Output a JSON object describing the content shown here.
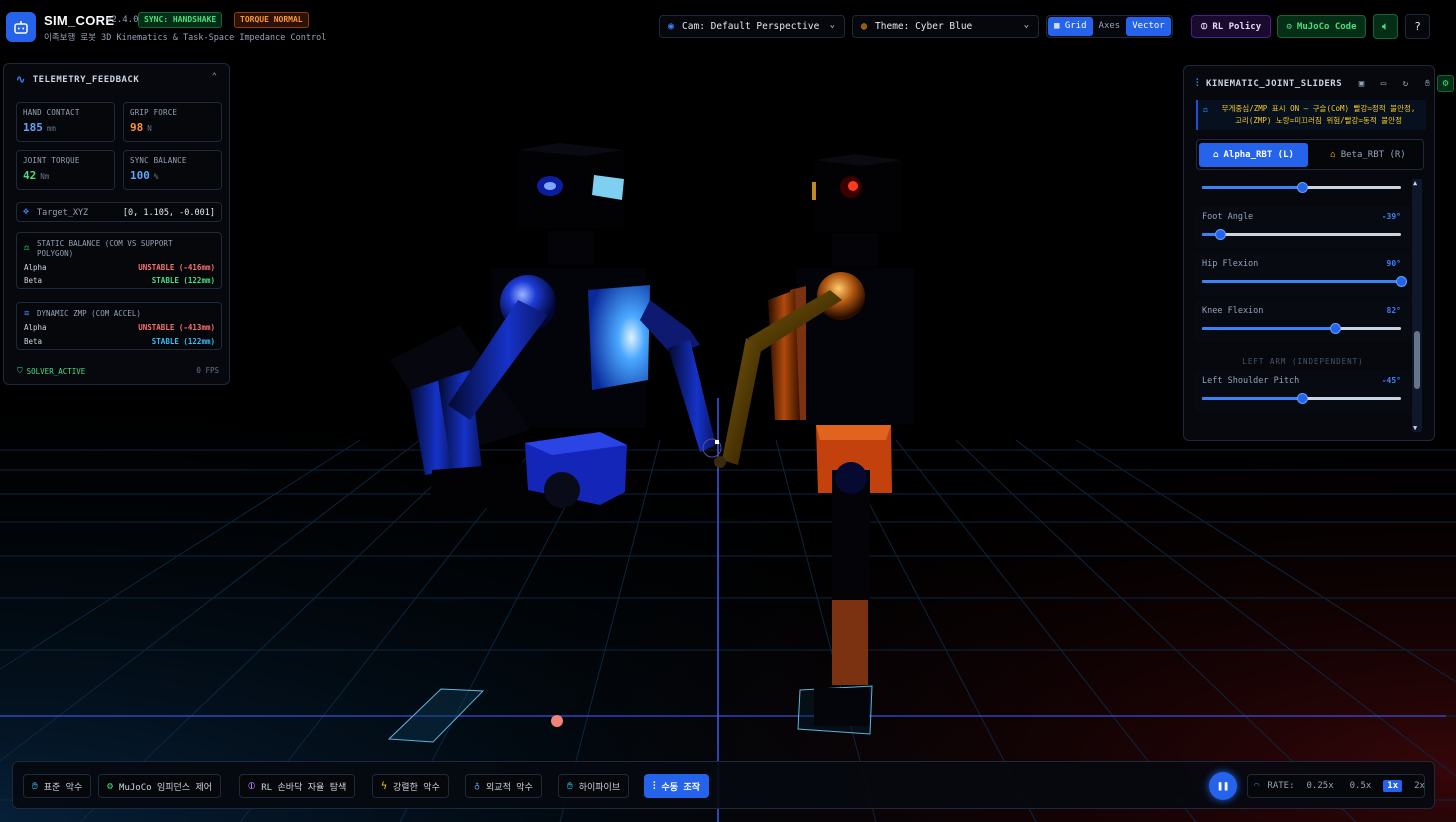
{
  "header": {
    "title": "SIM_CORE",
    "version": "v2.4.0",
    "badge_sync": "SYNC: HANDSHAKE",
    "badge_torque": "TORQUE NORMAL",
    "subtitle": "이족보행 로봇 3D Kinematics & Task-Space Impedance Control",
    "camera_select": "Cam: Default Perspective",
    "theme_select": "Theme: Cyber Blue",
    "toggles": [
      "Grid",
      "Axes",
      "Vector"
    ],
    "toggles_active": [
      "Grid",
      "Vector"
    ],
    "rl_policy_label": "RL Policy",
    "mujoco_code_label": "MuJoCo Code"
  },
  "telemetry": {
    "title": "TELEMETRY_FEEDBACK",
    "cards": [
      {
        "label": "HAND CONTACT",
        "value": "185",
        "unit": "mm",
        "color": "#60a5fa"
      },
      {
        "label": "GRIP FORCE",
        "value": "98",
        "unit": "N",
        "color": "#fb923c"
      },
      {
        "label": "JOINT TORQUE",
        "value": "42",
        "unit": "Nm",
        "color": "#4ade80"
      },
      {
        "label": "SYNC BALANCE",
        "value": "100",
        "unit": "%",
        "color": "#60a5fa"
      }
    ],
    "target_label": "Target_XYZ",
    "target_value": "[0, 1.105, -0.001]",
    "static_title": "STATIC BALANCE (COM VS SUPPORT POLYGON)",
    "static_alpha_label": "Alpha",
    "static_alpha_value": "UNSTABLE (-416mm)",
    "static_beta_label": "Beta",
    "static_beta_value": "STABLE (122mm)",
    "zmp_title": "DYNAMIC ZMP (COM ACCEL)",
    "zmp_alpha_label": "Alpha",
    "zmp_alpha_value": "UNSTABLE (-413mm)",
    "zmp_beta_label": "Beta",
    "zmp_beta_value": "STABLE (122mm)",
    "solver_status": "SOLVER_ACTIVE",
    "fps": "0 FPS"
  },
  "kinematic": {
    "title": "KINEMATIC_JOINT_SLIDERS",
    "note": "무게중심/ZMP 표시 ON — 구슬(CoM) 빨강=정적 불안정, 고리(ZMP) 노랑=미끄러짐 위험/빨강=동적 불안정",
    "tab_alpha": "Alpha_RBT (L)",
    "tab_beta": "Beta_RBT (R)",
    "top_slider_fraction": 0.5,
    "sliders": [
      {
        "label": "Foot Angle",
        "value": "-39°",
        "fraction": 0.09
      },
      {
        "label": "Hip Flexion",
        "value": "90°",
        "fraction": 1.0
      },
      {
        "label": "Knee Flexion",
        "value": "82°",
        "fraction": 0.67
      }
    ],
    "section_left_arm": "LEFT ARM (INDEPENDENT)",
    "left_arm_slider": {
      "label": "Left Shoulder Pitch",
      "value": "-45°",
      "fraction": 0.5
    }
  },
  "bottom": {
    "modes": [
      "표준 악수",
      "MuJoCo 임피던스 제어",
      "RL 손바닥 자율 탐색",
      "강렬한 악수",
      "외교적 악수",
      "하이파이브",
      "수동 조작"
    ],
    "active_mode": "수동 조작",
    "rate_label": "RATE:",
    "rates": [
      "0.25x",
      "0.5x",
      "1x",
      "2x"
    ],
    "active_rate": "1x"
  },
  "colors": {
    "accent": "#2563eb",
    "stable": "#4ade80",
    "unstable": "#f87171",
    "alpha_robot": "#1d4ed8",
    "beta_robot": "#c2410c"
  }
}
